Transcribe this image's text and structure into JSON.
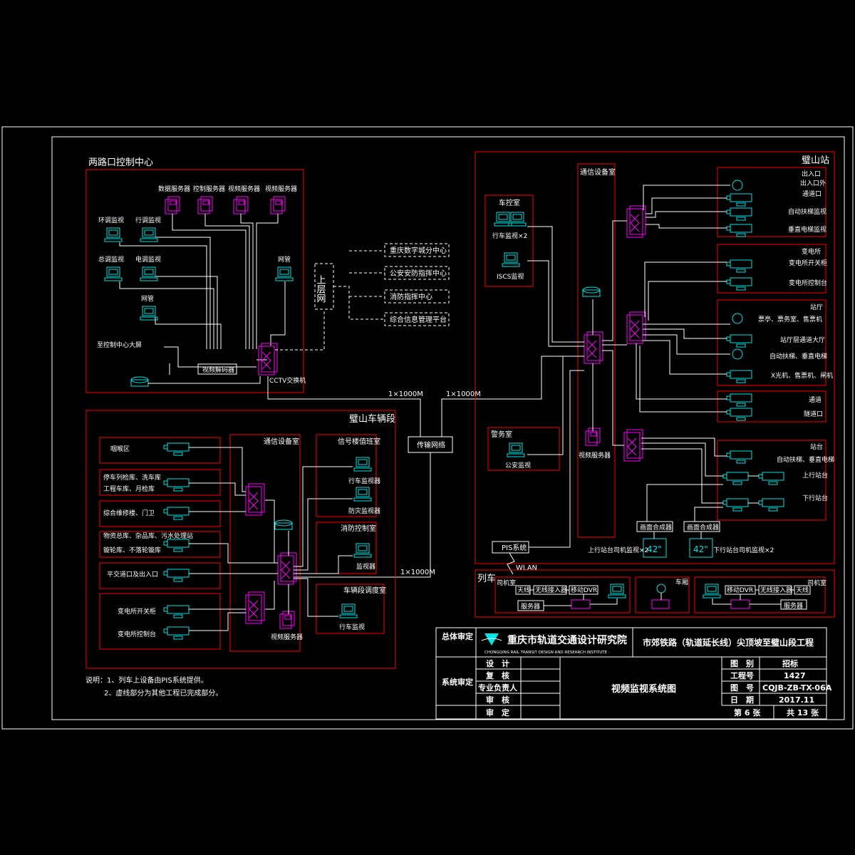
{
  "liangkou": {
    "title": "两路口控制中心",
    "servers": [
      "数据服务器",
      "控制服务器",
      "视频服务器",
      "视频服务器"
    ],
    "terminals": [
      "环调监视",
      "行调监视",
      "总调监视",
      "电调监视",
      "网管",
      "网管"
    ],
    "big_screen": "至控制中心大屏",
    "decoder": "视频解码器",
    "cctv_switch": "CCTV交换机"
  },
  "upper_network": {
    "label": "上层网",
    "targets": [
      "重庆数字城分中心",
      "公安安防指挥中心",
      "消防指挥中心",
      "综合信息管理平台"
    ]
  },
  "transmission": {
    "label": "传输网络",
    "link_left": "1×1000M",
    "link_right": "1×1000M",
    "link_depot": "1×1000M"
  },
  "bishan_station": {
    "title": "璧山站",
    "control_room": "车控室",
    "dispatch_monitor": "行车监视×2",
    "iscs_monitor": "ISCS监视",
    "comm_room": "通信设备室",
    "video_server": "视频服务器",
    "police_room": "警务室",
    "police_monitor": "公安监视",
    "pis": "PIS系统",
    "wlan": "WLAN",
    "entrance": {
      "title": "出入口",
      "items": [
        "出入口外",
        "通道口",
        "自动扶梯监视",
        "垂直电梯监视"
      ]
    },
    "substation": {
      "title": "变电所",
      "items": [
        "变电所开关柜",
        "变电所控制台"
      ]
    },
    "hall": {
      "title": "站厅",
      "items": [
        "票亭、票务室、售票机",
        "站厅层通道大厅",
        "自动扶梯、垂直电梯",
        "X光机、售票机、闸机"
      ]
    },
    "mezz": {
      "items": [
        "通道",
        "隧道口"
      ]
    },
    "platform": {
      "title": "站台",
      "items": [
        "自动扶梯、垂直电梯",
        "上行站台",
        "下行站台"
      ]
    },
    "splitters": [
      "画面合成器",
      "画面合成器"
    ],
    "display_up": "上行站台司机监视×2",
    "display_down": "下行站台司机监视×2",
    "display_size": "42\""
  },
  "depot": {
    "title": "璧山车辆段",
    "cameras": [
      "咽喉区",
      "停车列检库、洗车库",
      "工程车库、月检库",
      "综合维修楼、门卫",
      "物资总库、杂品库、污水处理站",
      "镟轮库、不落轮镟库",
      "平交道口及出入口",
      "变电所开关柜",
      "变电所控制台"
    ],
    "comm_room": "通信设备室",
    "signal_room": "信号楼值班室",
    "signal_monitors": [
      "行车监视器",
      "防灾监视器"
    ],
    "fire_room": "消防控制室",
    "fire_monitor": "监视器",
    "duty_room": "车辆段调度室",
    "duty_monitor": "行车监视",
    "server": "视频服务器"
  },
  "train": {
    "title": "列车",
    "cab_left": "司机室",
    "cab_right": "司机室",
    "car": "车厢",
    "items": [
      "天线",
      "无线接入器",
      "移动DVR",
      "服务器"
    ]
  },
  "notes": {
    "line1": "说明：1、列车上设备由PIS系统提供。",
    "line2": "2、虚线部分为其他工程已完成部分。"
  },
  "title_block": {
    "org_cn": "重庆市轨道交通设计研究院",
    "org_en": "CHONGQING RAIL TRANSIT DESIGN AND RESEARCH INSTITUTE",
    "project": "市郊铁路（轨道延长线）尖顶坡至璧山段工程",
    "drawing_title": "视频监视系统图",
    "left_labels": [
      "总体审定",
      "系统审定"
    ],
    "roles": [
      "设　计",
      "复　核",
      "专业负责人",
      "审　核",
      "审　定"
    ],
    "fields": [
      {
        "label": "图　别",
        "value": "招标"
      },
      {
        "label": "工程号",
        "value": "1427"
      },
      {
        "label": "图　号",
        "value": "CQJB-ZB-TX-06A"
      },
      {
        "label": "日　期",
        "value": "2017.11"
      }
    ],
    "sheet": "第 6 张",
    "total": "共 13 张"
  }
}
